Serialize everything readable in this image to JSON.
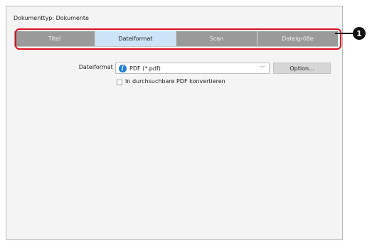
{
  "header": {
    "document_type": "Dokumenttyp: Dokumente"
  },
  "tabs": [
    {
      "label": "Titel",
      "active": false
    },
    {
      "label": "Dateiformat",
      "active": true
    },
    {
      "label": "Scan",
      "active": false
    },
    {
      "label": "Dateigröße",
      "active": false
    }
  ],
  "form": {
    "file_format_label": "Dateiformat  :",
    "file_format_value": "PDF (*.pdf)",
    "option_button": "Option...",
    "searchable_pdf_label": "In durchsuchbare PDF konvertieren",
    "searchable_pdf_checked": false
  },
  "callout": {
    "number": "1"
  },
  "colors": {
    "tab_inactive": "#9a9a9a",
    "tab_active": "#cde3f7",
    "callout_outline": "#e0101e",
    "pdf_icon": "#1e7fd4"
  },
  "icons": {
    "pdf": "pdf-icon",
    "dropdown": "chevron-down-icon"
  }
}
